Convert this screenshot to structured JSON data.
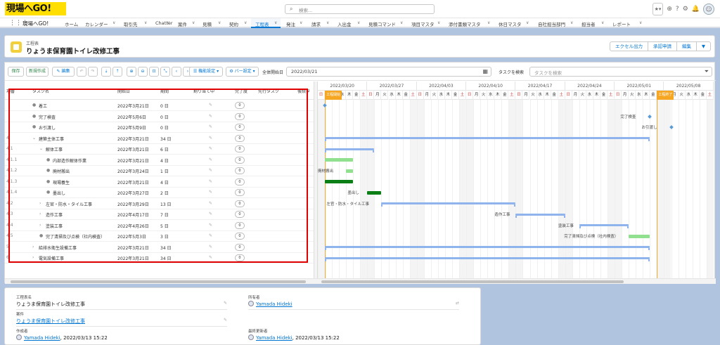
{
  "app": {
    "logo_text": "現場へGO!",
    "search_placeholder": "検索...",
    "app_name": "現場へGO!",
    "nav": [
      "ホーム",
      "カレンダー",
      "取引先",
      "Chatter",
      "案件",
      "見積",
      "契約",
      "工程表",
      "発注",
      "請求",
      "入出金",
      "見積コマンド",
      "項目マスタ",
      "添付書類マスタ",
      "休日マスタ",
      "自社担当部門",
      "担当者",
      "レポート"
    ],
    "active_nav": "工程表",
    "icons": [
      "star-icon",
      "add-icon",
      "help-icon",
      "gear-icon",
      "bell-icon",
      "avatar-icon"
    ]
  },
  "header": {
    "object_label": "工程表",
    "title": "りょうま保育園トイレ改修工事",
    "buttons": [
      "エクセル出力",
      "承認申請",
      "編集",
      "▼"
    ]
  },
  "toolbar": {
    "save": "保存",
    "new": "新規作成",
    "edit": "✎ 編集",
    "function_settings": "☰ 機能設定 ▾",
    "bar_settings": "⚙ バー設定 ▾",
    "overall_start_label": "全体開始日",
    "overall_start_value": "2022/03/21",
    "task_search_label": "タスクを検索",
    "task_search_placeholder": "タスクを検索"
  },
  "columns": [
    "項番",
    "タスク名",
    "開始日",
    "期間",
    "割り当て中",
    "完了度",
    "先行タスク",
    "後続タ"
  ],
  "tasks": [
    {
      "no": "",
      "name": "着工",
      "start": "2022年3月21日",
      "duration": "0 日",
      "progress": "0",
      "level": 0,
      "type": "leaf"
    },
    {
      "no": "",
      "name": "完了検査",
      "start": "2022年5月6日",
      "duration": "0 日",
      "progress": "0",
      "level": 0,
      "type": "leaf"
    },
    {
      "no": "",
      "name": "お引渡し",
      "start": "2022年5月9日",
      "duration": "0 日",
      "progress": "0",
      "level": 0,
      "type": "leaf"
    },
    {
      "no": "4",
      "name": "建築主体工事",
      "start": "2022年3月21日",
      "duration": "34 日",
      "progress": "0",
      "level": 0,
      "type": "open"
    },
    {
      "no": "4.1",
      "name": "解体工事",
      "start": "2022年3月21日",
      "duration": "6 日",
      "progress": "0",
      "level": 1,
      "type": "open"
    },
    {
      "no": "4.1.1",
      "name": "内部造作解体作業",
      "start": "2022年3月21日",
      "duration": "4 日",
      "progress": "0",
      "level": 2,
      "type": "leaf"
    },
    {
      "no": "4.1.2",
      "name": "廃材搬出",
      "start": "2022年3月24日",
      "duration": "1 日",
      "progress": "0",
      "level": 2,
      "type": "leaf"
    },
    {
      "no": "4.1.3",
      "name": "現場養生",
      "start": "2022年3月21日",
      "duration": "4 日",
      "progress": "0",
      "level": 2,
      "type": "leaf"
    },
    {
      "no": "4.1.4",
      "name": "墨出し",
      "start": "2022年3月27日",
      "duration": "2 日",
      "progress": "0",
      "level": 2,
      "type": "leaf"
    },
    {
      "no": "4.2",
      "name": "左官・防水・タイル工事",
      "start": "2022年3月29日",
      "duration": "13 日",
      "progress": "0",
      "level": 1,
      "type": "closed"
    },
    {
      "no": "4.3",
      "name": "造作工事",
      "start": "2022年4月17日",
      "duration": "7 日",
      "progress": "0",
      "level": 1,
      "type": "closed"
    },
    {
      "no": "4.4",
      "name": "塗装工事",
      "start": "2022年4月26日",
      "duration": "5 日",
      "progress": "0",
      "level": 1,
      "type": "closed"
    },
    {
      "no": "4.5",
      "name": "完了清掃及び点検（社内検査）",
      "start": "2022年5月3日",
      "duration": "3 日",
      "progress": "0",
      "level": 1,
      "type": "leaf"
    },
    {
      "no": "5",
      "name": "給排水衛生設備工事",
      "start": "2022年3月21日",
      "duration": "34 日",
      "progress": "0",
      "level": 0,
      "type": "closed"
    },
    {
      "no": "6",
      "name": "電気設備工事",
      "start": "2022年3月21日",
      "duration": "34 日",
      "progress": "0",
      "level": 0,
      "type": "closed"
    }
  ],
  "timeline": {
    "weeks": [
      "2022/03/20",
      "2022/03/27",
      "2022/04/03",
      "2022/04/10",
      "2022/04/17",
      "2022/04/24",
      "2022/05/01",
      "2022/05/08"
    ],
    "day_labels": [
      "日",
      "月",
      "火",
      "水",
      "木",
      "金",
      "土"
    ],
    "start_flag": "工程開始",
    "end_flag": "工程終了",
    "bar_labels": {
      "kanryo": "完了検査",
      "hikiwatashi": "お引渡し",
      "haizai": "廃材搬出",
      "sumidashi": "墨出し",
      "sakan": "左官・防水・タイル工事",
      "zousaku": "造作工事",
      "tosou": "塗装工事",
      "seisou": "完了清掃及び点検（社内検査）"
    }
  },
  "detail": {
    "schedule_name_label": "工程表名",
    "schedule_name_value": "りょうま保育園トイレ改修工事",
    "case_label": "案件",
    "case_value": "りょうま保育園トイレ改修工事",
    "creator_label": "作成者",
    "creator_value": "Yamada Hideki",
    "creator_date": ", 2022/03/13 15:22",
    "owner_label": "所有者",
    "owner_value": "Yamada Hideki",
    "updater_label": "最終更新者",
    "updater_value": "Yamada Hideki",
    "updater_date": ", 2022/03/13 15:22"
  },
  "colors": {
    "accent": "#0176d3",
    "highlight": "#e00000",
    "flag": "#f5a623",
    "summary_bar": "#8fb3ec",
    "task_bar": "#90e090",
    "task_bar_dark": "#0b7f16"
  }
}
